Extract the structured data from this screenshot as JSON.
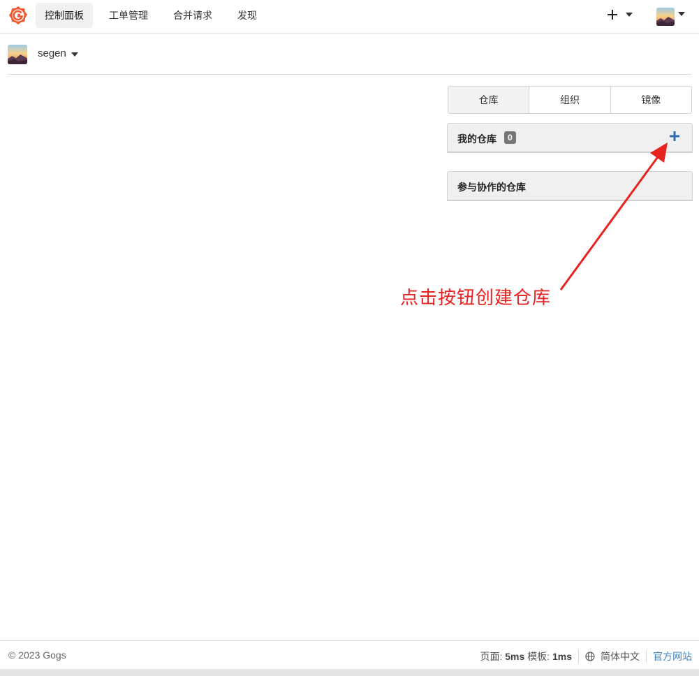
{
  "nav": {
    "items": [
      {
        "label": "控制面板",
        "active": true
      },
      {
        "label": "工单管理"
      },
      {
        "label": "合并请求"
      },
      {
        "label": "发现"
      }
    ],
    "plus_symbol": "+"
  },
  "context": {
    "username": "segen"
  },
  "tabs": [
    "仓库",
    "组织",
    "镜像"
  ],
  "panels": {
    "my_repos": {
      "title": "我的仓库",
      "count": "0"
    },
    "collab_repos": {
      "title": "参与协作的仓库"
    }
  },
  "annotation": {
    "text": "点击按钮创建仓库",
    "color": "#e8231f"
  },
  "footer": {
    "copyright": "© 2023 Gogs",
    "page_label": "页面:",
    "page_time": "5ms",
    "template_label": "模板:",
    "template_time": "1ms",
    "language": "简体中文",
    "official_site": "官方网站"
  },
  "colors": {
    "brand": "#f15a30",
    "link": "#4183c4",
    "plus_button": "#2f6fb0"
  },
  "icons": [
    "gogs-logo-icon",
    "plus-icon",
    "caret-down-icon",
    "avatar",
    "globe-icon"
  ]
}
